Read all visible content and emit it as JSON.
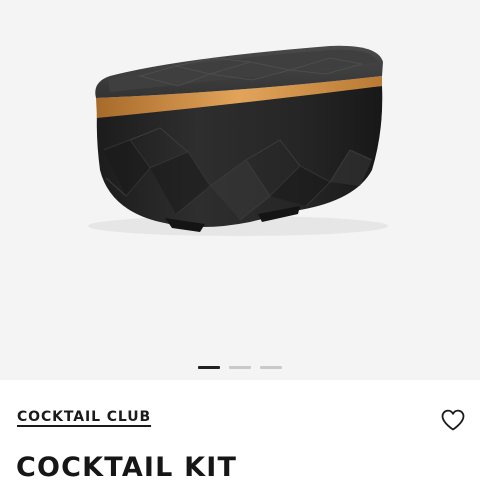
{
  "gallery": {
    "image_name": "black-faceted-box-with-wooden-lid-stripe",
    "slide_count": 3,
    "active_slide": 1
  },
  "product": {
    "brand": "COCKTAIL CLUB",
    "title": "COCKTAIL KIT"
  },
  "icons": {
    "wishlist": "heart-outline-icon"
  },
  "colors": {
    "gallery_background": "#f4f4f4",
    "product_body": "#2b2b2b",
    "lid_band": "#c8883c",
    "active_dot": "#222222",
    "inactive_dot": "#c9c9c9",
    "text": "#1b1b1b"
  }
}
